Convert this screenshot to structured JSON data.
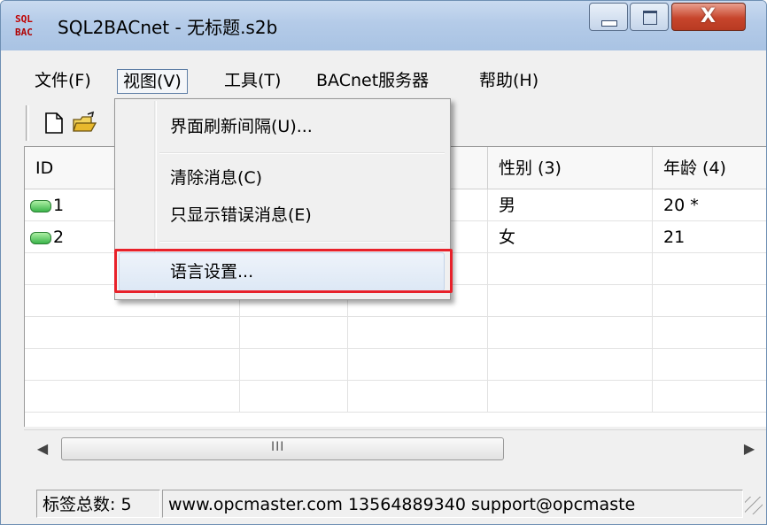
{
  "window": {
    "icon_text_top": "SQL",
    "icon_text_bottom": "BAC",
    "title": "SQL2BACnet - 无标题.s2b",
    "close_glyph": "X"
  },
  "menubar": {
    "items": [
      {
        "label": "文件(F)"
      },
      {
        "label": "视图(V)"
      },
      {
        "label": "工具(T)"
      },
      {
        "label": "BACnet服务器"
      },
      {
        "label": "帮助(H)"
      }
    ]
  },
  "toolbar": {
    "buttons": [
      {
        "icon": "new-file-icon"
      },
      {
        "icon": "open-folder-icon"
      }
    ]
  },
  "dropdown": {
    "items": [
      {
        "label": "界面刷新间隔(U)..."
      },
      {
        "label": "清除消息(C)"
      },
      {
        "label": "只显示错误消息(E)"
      },
      {
        "label": "语言设置..."
      }
    ],
    "highlighted_item": "语言设置..."
  },
  "grid": {
    "headers": [
      "ID",
      "",
      "",
      "性别 (3)",
      "年龄 (4)"
    ],
    "rows": [
      {
        "id": "1",
        "gender": "男",
        "age": "20 *"
      },
      {
        "id": "2",
        "gender": "女",
        "age": "21"
      }
    ]
  },
  "scrollbar": {
    "left_arrow": "◀",
    "right_arrow": "▶",
    "grip": "III"
  },
  "statusbar": {
    "tag_count": "标签总数: 5",
    "contact": "www.opcmaster.com 13564889340 support@opcmaste"
  },
  "colors": {
    "highlight_border": "#e8212a",
    "titlebar": "#b4cbe8",
    "tag_icon": "#3bb54a"
  }
}
